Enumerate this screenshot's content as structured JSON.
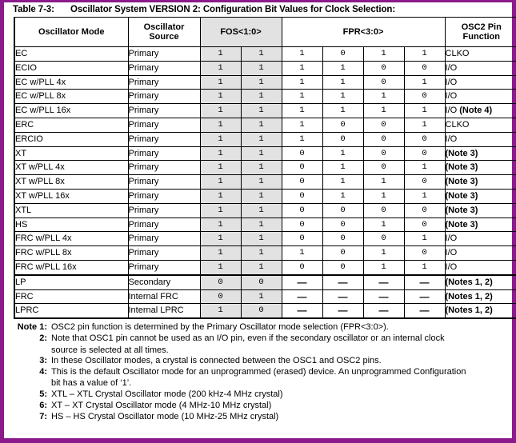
{
  "title": {
    "label": "Table 7-3:",
    "text": "Oscillator System VERSION 2: Configuration Bit Values for Clock Selection:"
  },
  "table": {
    "headers": {
      "mode": "Oscillator Mode",
      "source": "Oscillator Source",
      "fos": "FOS<1:0>",
      "fpr": "FPR<3:0>",
      "osc2": "OSC2 Pin Function"
    },
    "shaded_color": "#e2e2e2",
    "rows": [
      {
        "mode": "EC",
        "source": "Primary",
        "fos": [
          "1",
          "1"
        ],
        "fpr": [
          "1",
          "0",
          "1",
          "1"
        ],
        "osc2": "CLKO",
        "osc2_bold": "",
        "group_break": false
      },
      {
        "mode": "ECIO",
        "source": "Primary",
        "fos": [
          "1",
          "1"
        ],
        "fpr": [
          "1",
          "1",
          "0",
          "0"
        ],
        "osc2": "I/O",
        "osc2_bold": "",
        "group_break": false
      },
      {
        "mode": "EC w/PLL 4x",
        "source": "Primary",
        "fos": [
          "1",
          "1"
        ],
        "fpr": [
          "1",
          "1",
          "0",
          "1"
        ],
        "osc2": "I/O",
        "osc2_bold": "",
        "group_break": false
      },
      {
        "mode": "EC w/PLL 8x",
        "source": "Primary",
        "fos": [
          "1",
          "1"
        ],
        "fpr": [
          "1",
          "1",
          "1",
          "0"
        ],
        "osc2": "I/O",
        "osc2_bold": "",
        "group_break": false
      },
      {
        "mode": "EC w/PLL 16x",
        "source": "Primary",
        "fos": [
          "1",
          "1"
        ],
        "fpr": [
          "1",
          "1",
          "1",
          "1"
        ],
        "osc2": "I/O ",
        "osc2_bold": "(Note 4)",
        "group_break": false
      },
      {
        "mode": "ERC",
        "source": "Primary",
        "fos": [
          "1",
          "1"
        ],
        "fpr": [
          "1",
          "0",
          "0",
          "1"
        ],
        "osc2": "CLKO",
        "osc2_bold": "",
        "group_break": false
      },
      {
        "mode": "ERCIO",
        "source": "Primary",
        "fos": [
          "1",
          "1"
        ],
        "fpr": [
          "1",
          "0",
          "0",
          "0"
        ],
        "osc2": "I/O",
        "osc2_bold": "",
        "group_break": false
      },
      {
        "mode": "XT",
        "source": "Primary",
        "fos": [
          "1",
          "1"
        ],
        "fpr": [
          "0",
          "1",
          "0",
          "0"
        ],
        "osc2": "",
        "osc2_bold": "(Note 3)",
        "group_break": false
      },
      {
        "mode": "XT w/PLL 4x",
        "source": "Primary",
        "fos": [
          "1",
          "1"
        ],
        "fpr": [
          "0",
          "1",
          "0",
          "1"
        ],
        "osc2": "",
        "osc2_bold": "(Note 3)",
        "group_break": false
      },
      {
        "mode": "XT w/PLL 8x",
        "source": "Primary",
        "fos": [
          "1",
          "1"
        ],
        "fpr": [
          "0",
          "1",
          "1",
          "0"
        ],
        "osc2": "",
        "osc2_bold": "(Note 3)",
        "group_break": false
      },
      {
        "mode": "XT w/PLL 16x",
        "source": "Primary",
        "fos": [
          "1",
          "1"
        ],
        "fpr": [
          "0",
          "1",
          "1",
          "1"
        ],
        "osc2": "",
        "osc2_bold": "(Note 3)",
        "group_break": false
      },
      {
        "mode": "XTL",
        "source": "Primary",
        "fos": [
          "1",
          "1"
        ],
        "fpr": [
          "0",
          "0",
          "0",
          "0"
        ],
        "osc2": "",
        "osc2_bold": "(Note 3)",
        "group_break": false
      },
      {
        "mode": "HS",
        "source": "Primary",
        "fos": [
          "1",
          "1"
        ],
        "fpr": [
          "0",
          "0",
          "1",
          "0"
        ],
        "osc2": "",
        "osc2_bold": "(Note 3)",
        "group_break": false
      },
      {
        "mode": "FRC w/PLL 4x",
        "source": "Primary",
        "fos": [
          "1",
          "1"
        ],
        "fpr": [
          "0",
          "0",
          "0",
          "1"
        ],
        "osc2": "I/O",
        "osc2_bold": "",
        "group_break": false
      },
      {
        "mode": "FRC w/PLL 8x",
        "source": "Primary",
        "fos": [
          "1",
          "1"
        ],
        "fpr": [
          "1",
          "0",
          "1",
          "0"
        ],
        "osc2": "I/O",
        "osc2_bold": "",
        "group_break": false
      },
      {
        "mode": "FRC w/PLL 16x",
        "source": "Primary",
        "fos": [
          "1",
          "1"
        ],
        "fpr": [
          "0",
          "0",
          "1",
          "1"
        ],
        "osc2": "I/O",
        "osc2_bold": "",
        "group_break": false
      },
      {
        "mode": "LP",
        "source": "Secondary",
        "fos": [
          "0",
          "0"
        ],
        "fpr": [
          "—",
          "—",
          "—",
          "—"
        ],
        "osc2": "",
        "osc2_bold": "(Notes 1, 2)",
        "group_break": true
      },
      {
        "mode": "FRC",
        "source": "Internal FRC",
        "fos": [
          "0",
          "1"
        ],
        "fpr": [
          "—",
          "—",
          "—",
          "—"
        ],
        "osc2": "",
        "osc2_bold": "(Notes 1, 2)",
        "group_break": false
      },
      {
        "mode": "LPRC",
        "source": "Internal LPRC",
        "fos": [
          "1",
          "0"
        ],
        "fpr": [
          "—",
          "—",
          "—",
          "—"
        ],
        "osc2": "",
        "osc2_bold": "(Notes 1, 2)",
        "group_break": false
      }
    ]
  },
  "notes": {
    "heading": "Note",
    "items": [
      {
        "num": "Note 1:",
        "text": "OSC2 pin function is determined by the Primary Oscillator mode selection (FPR<3:0>).",
        "cont": ""
      },
      {
        "num": "2:",
        "text": "Note that OSC1 pin cannot be used as an I/O pin, even if the secondary oscillator or an internal clock",
        "cont": "source is selected at all times."
      },
      {
        "num": "3:",
        "text": "In these Oscillator modes, a crystal is connected between the OSC1 and OSC2 pins.",
        "cont": ""
      },
      {
        "num": "4:",
        "text": "This is the default Oscillator mode for an unprogrammed (erased) device. An unprogrammed Configuration",
        "cont": "bit has a value of ‘1’."
      },
      {
        "num": "5:",
        "text": "XTL – XTL Crystal Oscillator mode (200 kHz-4 MHz crystal)",
        "cont": ""
      },
      {
        "num": "6:",
        "text": "XT – XT Crystal Oscillator mode (4 MHz-10 MHz crystal)",
        "cont": ""
      },
      {
        "num": "7:",
        "text": "HS – HS Crystal Oscillator mode (10 MHz-25 MHz crystal)",
        "cont": ""
      }
    ]
  },
  "page_border_color": "#8B1A8B"
}
